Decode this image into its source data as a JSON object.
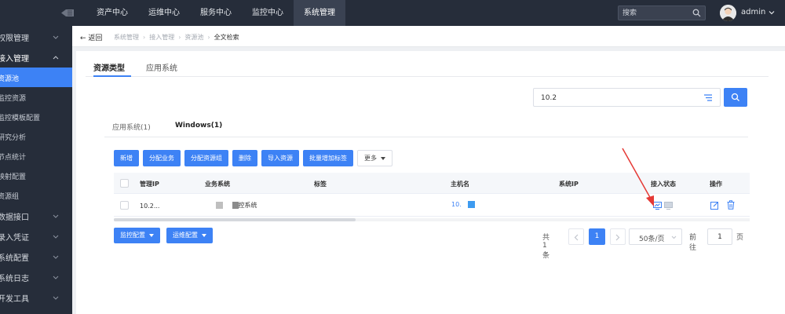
{
  "topbar": {
    "nav": [
      "资产中心",
      "运维中心",
      "服务中心",
      "监控中心",
      "系统管理"
    ],
    "active_nav": "系统管理",
    "search_placeholder": "搜索",
    "user": "admin"
  },
  "sidebar": {
    "items": [
      {
        "label": "权限管理",
        "chevron": "down"
      },
      {
        "label": "接入管理",
        "chevron": "up"
      },
      {
        "label": "资源池",
        "sub": true,
        "active": true
      },
      {
        "label": "监控资源",
        "sub": true
      },
      {
        "label": "监控模板配置",
        "sub": true
      },
      {
        "label": "研究分析",
        "sub": true
      },
      {
        "label": "节点统计",
        "sub": true
      },
      {
        "label": "映射配置",
        "sub": true
      },
      {
        "label": "资源组",
        "sub": true
      },
      {
        "label": "数据接口",
        "chevron": "down"
      },
      {
        "label": "录入凭证",
        "chevron": "down"
      },
      {
        "label": "系统配置",
        "chevron": "down"
      },
      {
        "label": "系统日志",
        "chevron": "down"
      },
      {
        "label": "开发工具",
        "chevron": "down"
      }
    ]
  },
  "breadcrumb": {
    "back": "返回",
    "items": [
      "系统管理",
      "接入管理",
      "资源池",
      "全文检索"
    ]
  },
  "main": {
    "tabs": [
      "资源类型",
      "应用系统"
    ],
    "filter_value": "10.2",
    "sub_tabs": [
      "应用系统(1)",
      "Windows(1)"
    ],
    "toolbar": [
      "新增",
      "分配业务",
      "分配资源组",
      "删除",
      "导入资源",
      "批量增加标签"
    ],
    "more": "更多",
    "table": {
      "columns": [
        "管理IP",
        "业务系统",
        "标签",
        "主机名",
        "系统IP",
        "接入状态",
        "操作"
      ],
      "rows": [
        {
          "ip": "10.2...",
          "biz": "控系统",
          "tag": "",
          "host": "10.",
          "sys_ip": ""
        }
      ]
    },
    "bottom_buttons": [
      "监控配置",
      "运维配置"
    ],
    "pagination": {
      "total": "共 1 条",
      "page": "1",
      "page_size": "50条/页",
      "goto_prefix": "前往",
      "goto_value": "1",
      "goto_suffix": "页"
    }
  },
  "colors": {
    "primary": "#3d82f5",
    "topbar": "#262d3a",
    "annotation_arrow": "#e53935"
  }
}
